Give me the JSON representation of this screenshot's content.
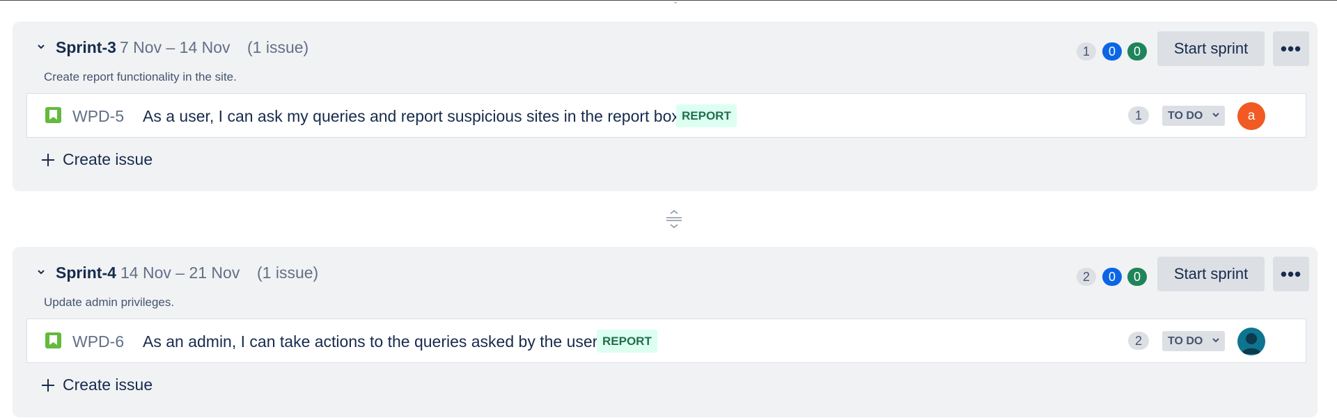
{
  "sprints": [
    {
      "name": "Sprint-3",
      "dates": "7 Nov – 14 Nov",
      "issue_count": "(1 issue)",
      "goal": "Create report functionality in the site.",
      "counts": {
        "todo": "1",
        "in_progress": "0",
        "done": "0"
      },
      "start_label": "Start sprint",
      "more_label": "•••",
      "issue": {
        "key": "WPD-5",
        "summary": "As a user, I can ask my queries and report suspicious sites in the report box.",
        "epic": "REPORT",
        "estimate": "1",
        "status": "TO DO",
        "assignee_initial": "a",
        "assignee_color": "#f15a22"
      },
      "create_label": "Create issue"
    },
    {
      "name": "Sprint-4",
      "dates": "14 Nov – 21 Nov",
      "issue_count": "(1 issue)",
      "goal": "Update admin privileges.",
      "counts": {
        "todo": "2",
        "in_progress": "0",
        "done": "0"
      },
      "start_label": "Start sprint",
      "more_label": "•••",
      "issue": {
        "key": "WPD-6",
        "summary": "As an admin, I can take actions to the queries asked by the user.",
        "epic": "REPORT",
        "estimate": "2",
        "status": "TO DO",
        "assignee_icon": "person-avatar-icon",
        "assignee_color": "#0e7490"
      },
      "create_label": "Create issue"
    }
  ],
  "colors": {
    "sprint_bg": "#f1f2f4",
    "todo_pill": "#dcdfe4",
    "in_progress_pill": "#0c66e4",
    "done_pill": "#1f845a",
    "story_icon": "#63ba3c",
    "epic_bg": "#dcfff1",
    "epic_text": "#216e4e"
  },
  "icons": {
    "section_toggle": "chevron-down-icon",
    "issue_type": "story-bookmark-icon",
    "create": "plus-icon",
    "resize": "drag-resize-handle-icon"
  }
}
